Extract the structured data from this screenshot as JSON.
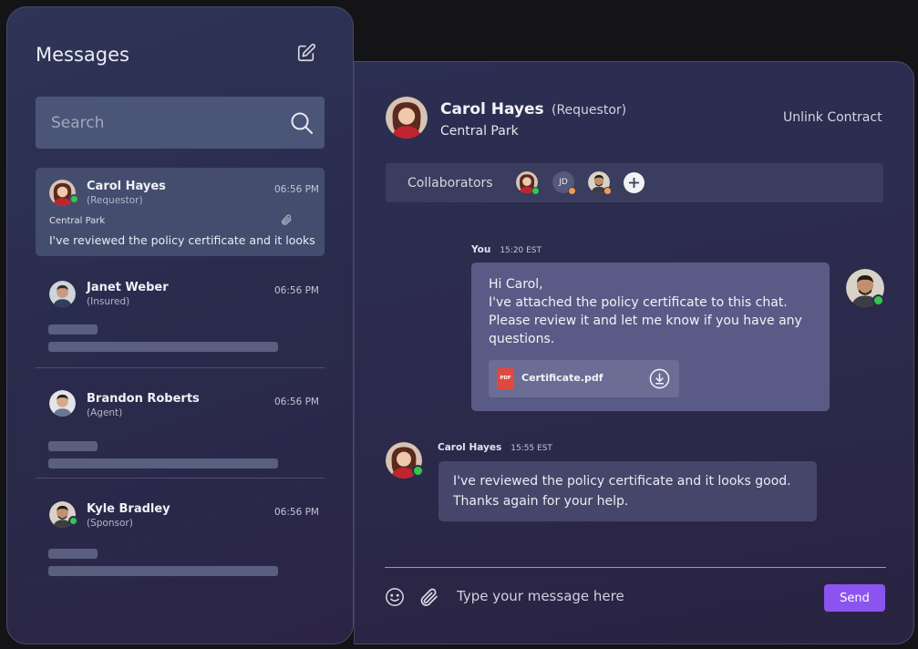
{
  "messages_panel": {
    "title": "Messages",
    "search": {
      "placeholder": "Search",
      "value": ""
    },
    "conversations": [
      {
        "name": "Carol Hayes",
        "role": "(Requestor)",
        "time": "06:56 PM",
        "location": "Central Park",
        "preview": "I've reviewed the policy certificate and it looks",
        "online": true,
        "has_attachment": true
      },
      {
        "name": "Janet Weber",
        "role": "(Insured)",
        "time": "06:56 PM",
        "online": false
      },
      {
        "name": "Brandon Roberts",
        "role": "(Agent)",
        "time": "06:56 PM",
        "online": false
      },
      {
        "name": "Kyle Bradley",
        "role": "(Sponsor)",
        "time": "06:56 PM",
        "online": true
      }
    ]
  },
  "chat": {
    "contact": {
      "name": "Carol Hayes",
      "role": "(Requestor)",
      "location": "Central Park"
    },
    "unlink_label": "Unlink Contract",
    "collaborators": {
      "label": "Collaborators",
      "members": [
        {
          "initials": "",
          "status_color": "#35c64a"
        },
        {
          "initials": "JD",
          "status_color": "#f29b4b"
        },
        {
          "initials": "",
          "status_color": "#f29b4b"
        }
      ]
    },
    "messages": [
      {
        "sender": "You",
        "time": "15:20 EST",
        "lines": [
          "Hi Carol,",
          "I've attached the policy certificate to this chat. Please review it and let me know if you have any questions."
        ],
        "attachment": {
          "type": "PDF",
          "name": "Certificate.pdf"
        }
      },
      {
        "sender": "Carol Hayes",
        "time": "15:55 EST",
        "lines": [
          "I've reviewed the policy certificate and it looks good.",
          "Thanks again for your help."
        ]
      }
    ],
    "composer": {
      "placeholder": "Type your message here",
      "send_label": "Send"
    }
  },
  "colors": {
    "accent": "#8b54ee",
    "online": "#35c64a",
    "away": "#f29b4b",
    "pdf": "#e0493f"
  }
}
